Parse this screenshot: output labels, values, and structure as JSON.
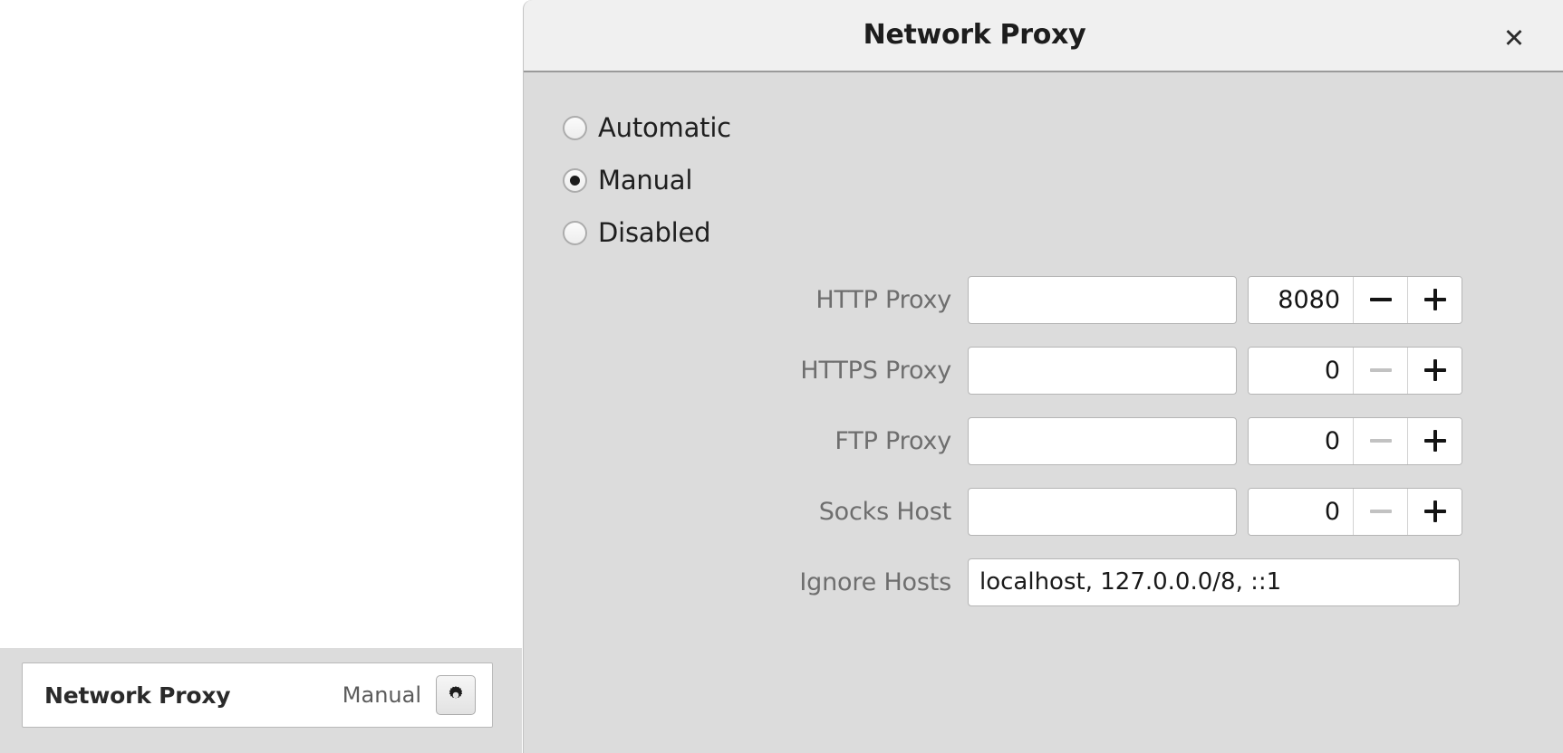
{
  "left_panel": {
    "proxy_row": {
      "title": "Network Proxy",
      "value": "Manual",
      "settings_icon": "gear-icon"
    }
  },
  "dialog": {
    "title": "Network Proxy",
    "close_label": "✕",
    "mode_options": [
      {
        "label": "Automatic",
        "selected": false
      },
      {
        "label": "Manual",
        "selected": true
      },
      {
        "label": "Disabled",
        "selected": false
      }
    ],
    "fields": [
      {
        "label": "HTTP Proxy",
        "host_value": "",
        "host_placeholder": "",
        "port_value": "8080",
        "minus_enabled": true,
        "plus_enabled": true,
        "minus_label": "−",
        "plus_label": "+"
      },
      {
        "label": "HTTPS Proxy",
        "host_value": "",
        "host_placeholder": "",
        "port_value": "0",
        "minus_enabled": false,
        "plus_enabled": true,
        "minus_label": "−",
        "plus_label": "+"
      },
      {
        "label": "FTP Proxy",
        "host_value": "",
        "host_placeholder": "",
        "port_value": "0",
        "minus_enabled": false,
        "plus_enabled": true,
        "minus_label": "−",
        "plus_label": "+"
      },
      {
        "label": "Socks Host",
        "host_value": "",
        "host_placeholder": "",
        "port_value": "0",
        "minus_enabled": false,
        "plus_enabled": true,
        "minus_label": "−",
        "plus_label": "+"
      }
    ],
    "ignore_hosts": {
      "label": "Ignore Hosts",
      "value": "localhost, 127.0.0.0/8, ::1",
      "placeholder": ""
    }
  },
  "colors": {
    "dialog_body": "#dcdcdc",
    "dialog_header": "#f0f0f0",
    "label_grey": "#6e6e6e",
    "text_dark": "#1a1a1a",
    "disabled_grey": "#c2c2c2"
  }
}
